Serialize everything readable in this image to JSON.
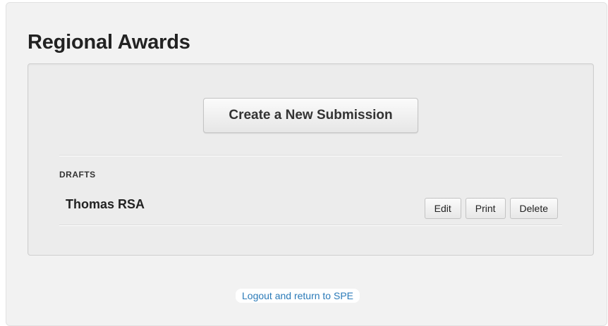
{
  "page": {
    "title": "Regional Awards"
  },
  "panel": {
    "create_button_label": "Create a New Submission",
    "drafts_section_label": "DRAFTS",
    "drafts": [
      {
        "name": "Thomas RSA",
        "actions": {
          "edit_label": "Edit",
          "print_label": "Print",
          "delete_label": "Delete"
        }
      }
    ]
  },
  "footer": {
    "logout_link_label": "Logout and return to SPE"
  },
  "colors": {
    "background": "#f2f2f2",
    "panel_background": "#ececec",
    "link": "#2a7ab8",
    "text": "#222222"
  }
}
